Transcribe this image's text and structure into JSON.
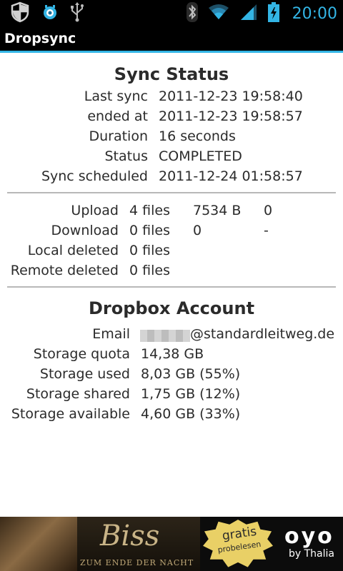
{
  "status_bar": {
    "time": "20:00",
    "icons": [
      "shield-icon",
      "sync-bot-icon",
      "usb-icon",
      "bluetooth-icon",
      "wifi-icon",
      "signal-icon",
      "battery-icon"
    ],
    "accent_color": "#33b5e5"
  },
  "app": {
    "title": "Dropsync"
  },
  "sync_status": {
    "heading": "Sync Status",
    "rows": [
      {
        "label": "Last sync",
        "value": "2011-12-23 19:58:40"
      },
      {
        "label": "ended at",
        "value": "2011-12-23 19:58:57"
      },
      {
        "label": "Duration",
        "value": "16 seconds"
      },
      {
        "label": "Status",
        "value": "COMPLETED"
      },
      {
        "label": "Sync scheduled",
        "value": "2011-12-24 01:58:57"
      }
    ]
  },
  "transfers": {
    "rows": [
      {
        "label": "Upload",
        "files": "4 files",
        "bytes": "7534 B",
        "count": "0"
      },
      {
        "label": "Download",
        "files": "0 files",
        "bytes": "0",
        "count": "-"
      },
      {
        "label": "Local deleted",
        "files": "0 files"
      },
      {
        "label": "Remote deleted",
        "files": "0 files"
      }
    ]
  },
  "account": {
    "heading": "Dropbox Account",
    "email_label": "Email",
    "email_domain": "@standardleitweg.de",
    "rows": [
      {
        "label": "Storage quota",
        "value": "14,38 GB"
      },
      {
        "label": "Storage used",
        "value": "8,03 GB (55%)"
      },
      {
        "label": "Storage shared",
        "value": "1,75 GB (12%)"
      },
      {
        "label": "Storage available",
        "value": "4,60 GB (33%)"
      }
    ]
  },
  "ad": {
    "title": "Biss",
    "subtitle": "ZUM ENDE DER NACHT",
    "badge_line1": "gratis",
    "badge_line2": "probelesen",
    "brand": "oyo",
    "brand_sub": "by Thalia"
  }
}
